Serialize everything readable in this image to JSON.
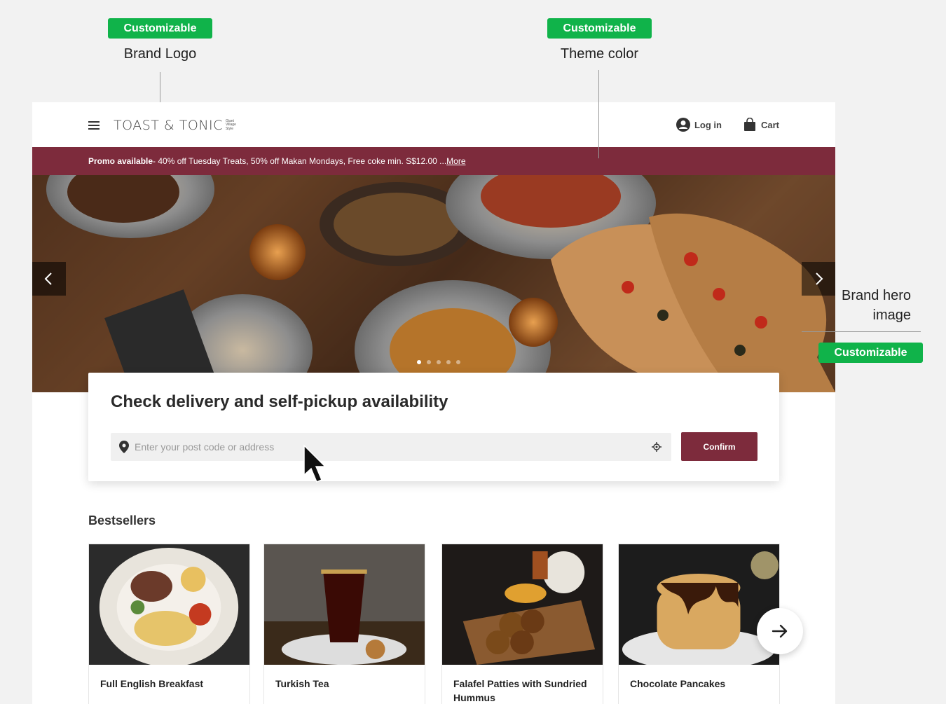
{
  "annotations": {
    "badge_text": "Customizable",
    "brand_logo_label": "Brand Logo",
    "theme_color_label": "Theme color",
    "hero_image_label_line1": "Brand hero",
    "hero_image_label_line2": "image"
  },
  "header": {
    "logo_text": "TOAST & TONIC",
    "logo_subtext": "Giant Village Style",
    "login_label": "Log in",
    "cart_label": "Cart",
    "icons": [
      "menu-icon",
      "user-icon",
      "cart-icon"
    ]
  },
  "promo": {
    "bold": "Promo available",
    "text": " - 40% off Tuesday Treats, 50% off Makan Mondays, Free coke min. S$12.00 ...",
    "more": "More"
  },
  "hero": {
    "slide_count": 5,
    "active_slide": 1,
    "icons": [
      "chevron-left-icon",
      "chevron-right-icon"
    ]
  },
  "availability": {
    "title": "Check delivery and self-pickup availability",
    "placeholder": "Enter your post code or address",
    "value": "",
    "confirm_label": "Confirm"
  },
  "bestsellers": {
    "title": "Bestsellers",
    "items": [
      {
        "name": "Full English Breakfast"
      },
      {
        "name": "Turkish Tea"
      },
      {
        "name": "Falafel Patties with Sundried Hummus"
      },
      {
        "name": "Chocolate Pancakes"
      }
    ]
  },
  "colors": {
    "theme": "#7d2b3c",
    "badge": "#10b34a"
  }
}
